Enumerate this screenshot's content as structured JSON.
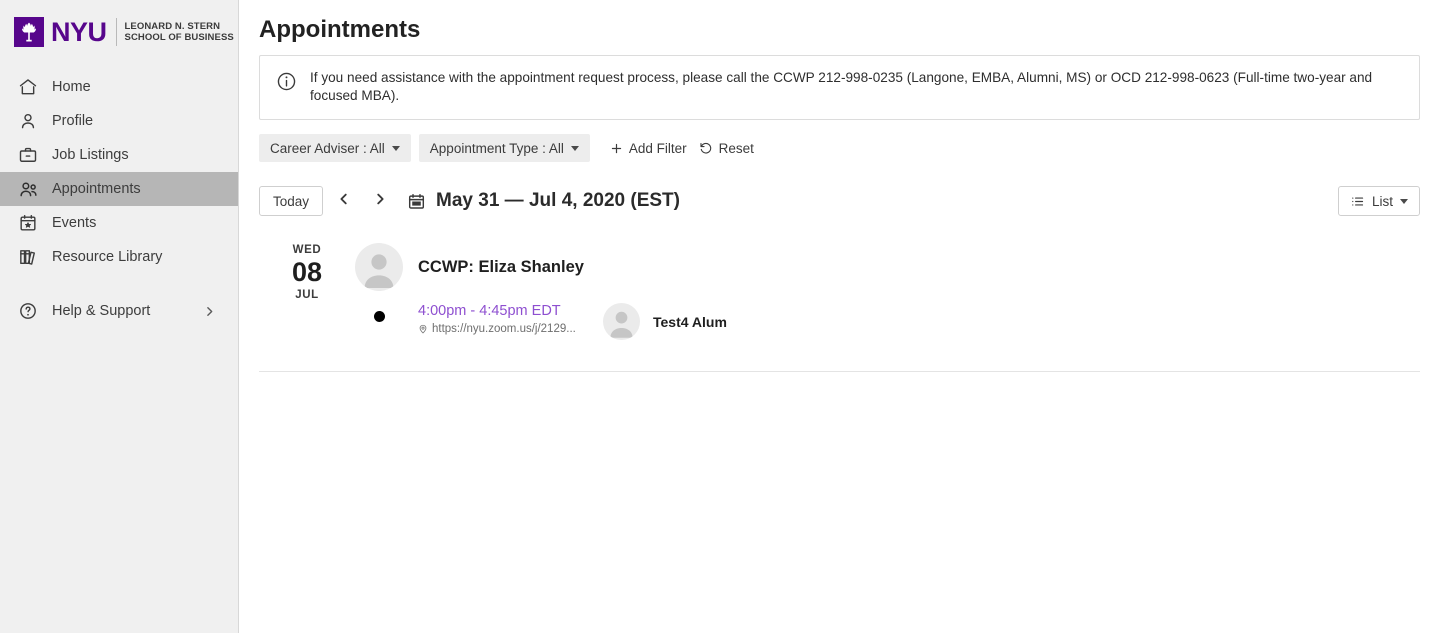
{
  "brand": {
    "logo_icon": "nyu-torch-icon",
    "wordmark": "NYU",
    "school_line1": "LEONARD N. STERN",
    "school_line2": "SCHOOL OF BUSINESS",
    "purple": "#57068c"
  },
  "sidebar": {
    "items": [
      {
        "label": "Home",
        "icon": "home-icon",
        "active": false
      },
      {
        "label": "Profile",
        "icon": "user-icon",
        "active": false
      },
      {
        "label": "Job Listings",
        "icon": "briefcase-icon",
        "active": false
      },
      {
        "label": "Appointments",
        "icon": "people-icon",
        "active": true
      },
      {
        "label": "Events",
        "icon": "calendar-star-icon",
        "active": false
      },
      {
        "label": "Resource Library",
        "icon": "books-icon",
        "active": false
      }
    ],
    "help": {
      "label": "Help & Support",
      "icon": "question-circle-icon",
      "chevron": "chevron-right-icon"
    }
  },
  "header": {
    "title": "Appointments"
  },
  "notice": {
    "icon": "info-circle-icon",
    "text": "If you need assistance with the appointment request process, please call the CCWP 212-998-0235 (Langone, EMBA, Alumni, MS) or OCD 212-998-0623 (Full-time two-year and focused MBA)."
  },
  "filters": {
    "pills": [
      {
        "label": "Career Adviser : All",
        "name": "career-adviser-filter"
      },
      {
        "label": "Appointment Type : All",
        "name": "appointment-type-filter"
      }
    ],
    "add_filter": {
      "label": "Add Filter",
      "icon": "plus-icon"
    },
    "reset": {
      "label": "Reset",
      "icon": "reset-icon"
    }
  },
  "toolbar": {
    "today_label": "Today",
    "prev_icon": "chevron-left-icon",
    "next_icon": "chevron-right-icon",
    "calendar_icon": "calendar-icon",
    "date_range": "May 31 — Jul 4, 2020 (EST)",
    "view": {
      "label": "List",
      "icon": "list-icon",
      "caret": "chevron-down-icon"
    }
  },
  "appointments": {
    "day": {
      "dow": "WED",
      "day": "08",
      "month": "JUL"
    },
    "group": {
      "avatar": "avatar-placeholder-icon",
      "title": "CCWP: Eliza Shanley"
    },
    "items": [
      {
        "status_dot": "#000000",
        "time": "4:00pm - 4:45pm EDT",
        "time_color": "#8e4fd0",
        "location_icon": "map-pin-icon",
        "location": "https://nyu.zoom.us/j/2129...",
        "guest_avatar": "avatar-placeholder-icon",
        "guest_name": "Test4 Alum"
      }
    ]
  }
}
